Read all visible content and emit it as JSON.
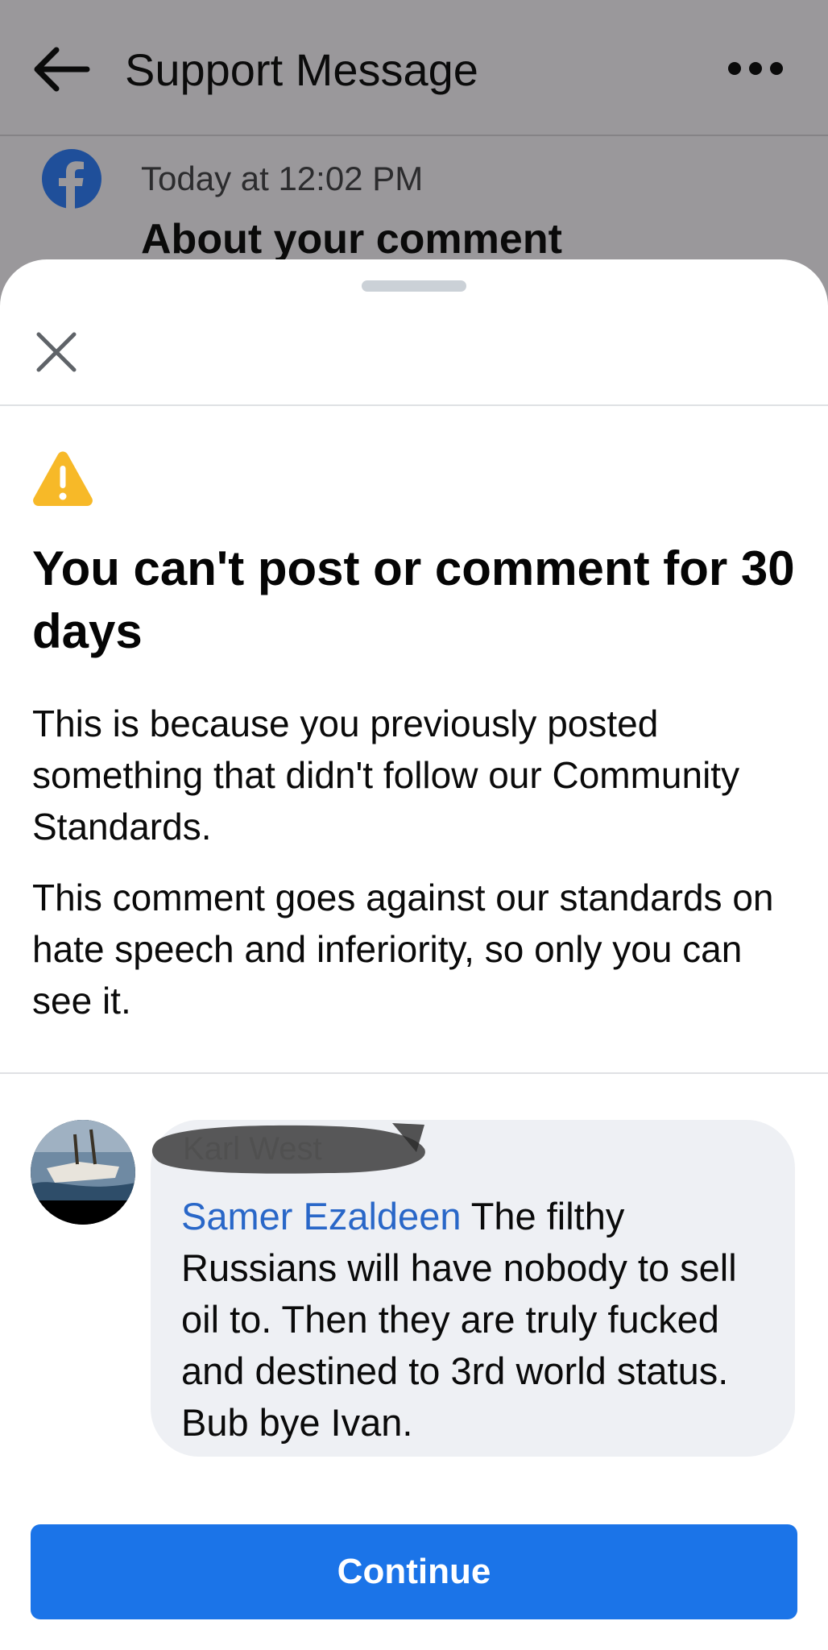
{
  "header": {
    "title": "Support Message",
    "back_icon": "arrow-left-icon",
    "more_icon": "more-horizontal-icon"
  },
  "message": {
    "sender_icon": "facebook-logo-icon",
    "timestamp": "Today at 12:02 PM",
    "subject": "About your comment"
  },
  "sheet": {
    "close_icon": "close-icon",
    "warning_icon": "warning-triangle-icon",
    "headline": "You can't post or comment for 30 days",
    "paragraphs": [
      "This is because you previously posted something that didn't follow our Community Standards.",
      "This comment goes against our standards on hate speech and inferiority, so only you can see it."
    ],
    "comment": {
      "author_name": "Karl West",
      "author_redacted": true,
      "mention": "Samer Ezaldeen",
      "text": " The filthy Russians will have nobody to sell oil to. Then they are truly fucked and destined to 3rd world status. Bub bye Ivan."
    },
    "continue_label": "Continue"
  },
  "colors": {
    "accent_blue": "#1b74e8",
    "mention_blue": "#2967c8",
    "warning_yellow": "#f7b928",
    "bubble_bg": "#eef0f4",
    "dim_overlay": "#9a989b"
  }
}
